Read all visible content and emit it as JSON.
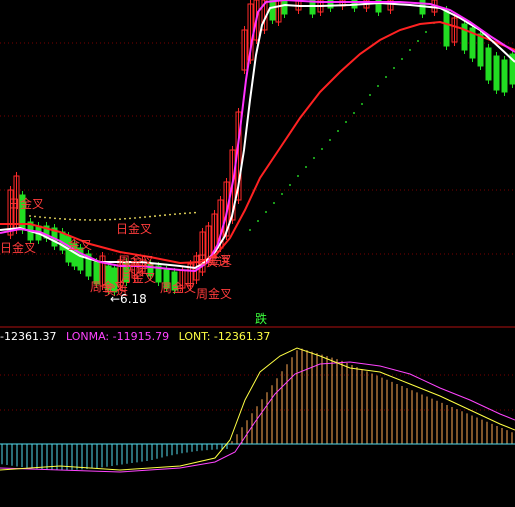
{
  "colors": {
    "background": "#000000",
    "grid": "#7a0000",
    "divider": "#b01010",
    "ma_white": "#ffffff",
    "ma_magenta": "#ff33ff",
    "ma_red": "#ff2222",
    "dots": "#22cc22",
    "macd_up": "#ffaa55",
    "macd_down": "#55ddee",
    "lonma_line": "#ff44ff",
    "lont_line": "#ffff44"
  },
  "price_panel": {
    "annotations": [
      {
        "text": "日金叉",
        "color": "red"
      },
      {
        "text": "日金叉",
        "color": "red"
      },
      {
        "text": "金叉",
        "color": "red"
      },
      {
        "text": "日金叉",
        "color": "red"
      },
      {
        "text": "月金叉",
        "color": "red"
      },
      {
        "text": "周金叉",
        "color": "red"
      },
      {
        "text": "买进",
        "color": "red"
      },
      {
        "text": "周金叉",
        "color": "red"
      },
      {
        "text": "周金叉",
        "color": "red"
      },
      {
        "text": "买进",
        "color": "red"
      },
      {
        "text": "周金叉",
        "color": "red"
      },
      {
        "text": "日金叉",
        "color": "red"
      },
      {
        "text": "买进",
        "color": "red"
      },
      {
        "text": "←6.18",
        "color": "white"
      },
      {
        "text": "跌",
        "color": "green"
      }
    ]
  },
  "indicator_panel": {
    "dif_label": "-12361.37",
    "lonma_label": "LONMA: -11915.79",
    "lont_label": "LONT: -12361.37"
  }
}
